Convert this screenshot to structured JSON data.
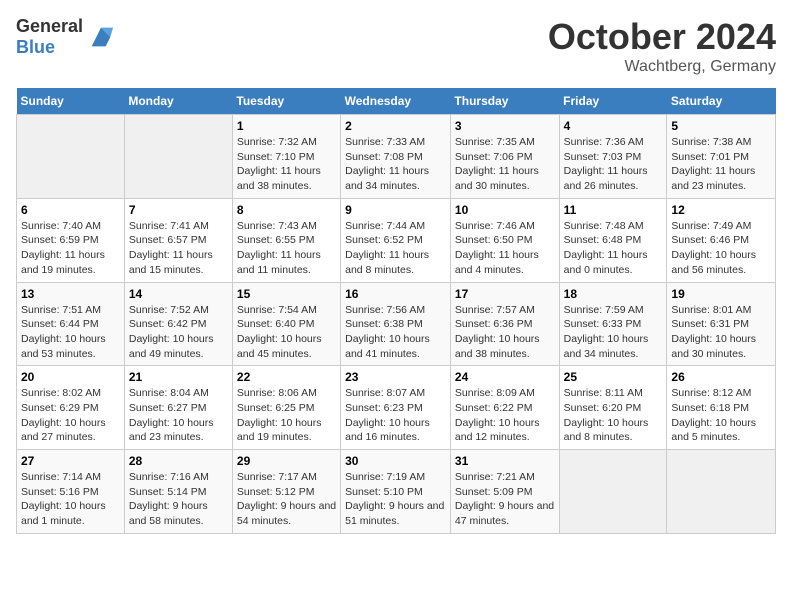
{
  "header": {
    "logo": {
      "general": "General",
      "blue": "Blue"
    },
    "month": "October 2024",
    "location": "Wachtberg, Germany"
  },
  "weekdays": [
    "Sunday",
    "Monday",
    "Tuesday",
    "Wednesday",
    "Thursday",
    "Friday",
    "Saturday"
  ],
  "weeks": [
    [
      {
        "day": null
      },
      {
        "day": null
      },
      {
        "day": "1",
        "sunrise": "Sunrise: 7:32 AM",
        "sunset": "Sunset: 7:10 PM",
        "daylight": "Daylight: 11 hours and 38 minutes."
      },
      {
        "day": "2",
        "sunrise": "Sunrise: 7:33 AM",
        "sunset": "Sunset: 7:08 PM",
        "daylight": "Daylight: 11 hours and 34 minutes."
      },
      {
        "day": "3",
        "sunrise": "Sunrise: 7:35 AM",
        "sunset": "Sunset: 7:06 PM",
        "daylight": "Daylight: 11 hours and 30 minutes."
      },
      {
        "day": "4",
        "sunrise": "Sunrise: 7:36 AM",
        "sunset": "Sunset: 7:03 PM",
        "daylight": "Daylight: 11 hours and 26 minutes."
      },
      {
        "day": "5",
        "sunrise": "Sunrise: 7:38 AM",
        "sunset": "Sunset: 7:01 PM",
        "daylight": "Daylight: 11 hours and 23 minutes."
      }
    ],
    [
      {
        "day": "6",
        "sunrise": "Sunrise: 7:40 AM",
        "sunset": "Sunset: 6:59 PM",
        "daylight": "Daylight: 11 hours and 19 minutes."
      },
      {
        "day": "7",
        "sunrise": "Sunrise: 7:41 AM",
        "sunset": "Sunset: 6:57 PM",
        "daylight": "Daylight: 11 hours and 15 minutes."
      },
      {
        "day": "8",
        "sunrise": "Sunrise: 7:43 AM",
        "sunset": "Sunset: 6:55 PM",
        "daylight": "Daylight: 11 hours and 11 minutes."
      },
      {
        "day": "9",
        "sunrise": "Sunrise: 7:44 AM",
        "sunset": "Sunset: 6:52 PM",
        "daylight": "Daylight: 11 hours and 8 minutes."
      },
      {
        "day": "10",
        "sunrise": "Sunrise: 7:46 AM",
        "sunset": "Sunset: 6:50 PM",
        "daylight": "Daylight: 11 hours and 4 minutes."
      },
      {
        "day": "11",
        "sunrise": "Sunrise: 7:48 AM",
        "sunset": "Sunset: 6:48 PM",
        "daylight": "Daylight: 11 hours and 0 minutes."
      },
      {
        "day": "12",
        "sunrise": "Sunrise: 7:49 AM",
        "sunset": "Sunset: 6:46 PM",
        "daylight": "Daylight: 10 hours and 56 minutes."
      }
    ],
    [
      {
        "day": "13",
        "sunrise": "Sunrise: 7:51 AM",
        "sunset": "Sunset: 6:44 PM",
        "daylight": "Daylight: 10 hours and 53 minutes."
      },
      {
        "day": "14",
        "sunrise": "Sunrise: 7:52 AM",
        "sunset": "Sunset: 6:42 PM",
        "daylight": "Daylight: 10 hours and 49 minutes."
      },
      {
        "day": "15",
        "sunrise": "Sunrise: 7:54 AM",
        "sunset": "Sunset: 6:40 PM",
        "daylight": "Daylight: 10 hours and 45 minutes."
      },
      {
        "day": "16",
        "sunrise": "Sunrise: 7:56 AM",
        "sunset": "Sunset: 6:38 PM",
        "daylight": "Daylight: 10 hours and 41 minutes."
      },
      {
        "day": "17",
        "sunrise": "Sunrise: 7:57 AM",
        "sunset": "Sunset: 6:36 PM",
        "daylight": "Daylight: 10 hours and 38 minutes."
      },
      {
        "day": "18",
        "sunrise": "Sunrise: 7:59 AM",
        "sunset": "Sunset: 6:33 PM",
        "daylight": "Daylight: 10 hours and 34 minutes."
      },
      {
        "day": "19",
        "sunrise": "Sunrise: 8:01 AM",
        "sunset": "Sunset: 6:31 PM",
        "daylight": "Daylight: 10 hours and 30 minutes."
      }
    ],
    [
      {
        "day": "20",
        "sunrise": "Sunrise: 8:02 AM",
        "sunset": "Sunset: 6:29 PM",
        "daylight": "Daylight: 10 hours and 27 minutes."
      },
      {
        "day": "21",
        "sunrise": "Sunrise: 8:04 AM",
        "sunset": "Sunset: 6:27 PM",
        "daylight": "Daylight: 10 hours and 23 minutes."
      },
      {
        "day": "22",
        "sunrise": "Sunrise: 8:06 AM",
        "sunset": "Sunset: 6:25 PM",
        "daylight": "Daylight: 10 hours and 19 minutes."
      },
      {
        "day": "23",
        "sunrise": "Sunrise: 8:07 AM",
        "sunset": "Sunset: 6:23 PM",
        "daylight": "Daylight: 10 hours and 16 minutes."
      },
      {
        "day": "24",
        "sunrise": "Sunrise: 8:09 AM",
        "sunset": "Sunset: 6:22 PM",
        "daylight": "Daylight: 10 hours and 12 minutes."
      },
      {
        "day": "25",
        "sunrise": "Sunrise: 8:11 AM",
        "sunset": "Sunset: 6:20 PM",
        "daylight": "Daylight: 10 hours and 8 minutes."
      },
      {
        "day": "26",
        "sunrise": "Sunrise: 8:12 AM",
        "sunset": "Sunset: 6:18 PM",
        "daylight": "Daylight: 10 hours and 5 minutes."
      }
    ],
    [
      {
        "day": "27",
        "sunrise": "Sunrise: 7:14 AM",
        "sunset": "Sunset: 5:16 PM",
        "daylight": "Daylight: 10 hours and 1 minute."
      },
      {
        "day": "28",
        "sunrise": "Sunrise: 7:16 AM",
        "sunset": "Sunset: 5:14 PM",
        "daylight": "Daylight: 9 hours and 58 minutes."
      },
      {
        "day": "29",
        "sunrise": "Sunrise: 7:17 AM",
        "sunset": "Sunset: 5:12 PM",
        "daylight": "Daylight: 9 hours and 54 minutes."
      },
      {
        "day": "30",
        "sunrise": "Sunrise: 7:19 AM",
        "sunset": "Sunset: 5:10 PM",
        "daylight": "Daylight: 9 hours and 51 minutes."
      },
      {
        "day": "31",
        "sunrise": "Sunrise: 7:21 AM",
        "sunset": "Sunset: 5:09 PM",
        "daylight": "Daylight: 9 hours and 47 minutes."
      },
      {
        "day": null
      },
      {
        "day": null
      }
    ]
  ]
}
